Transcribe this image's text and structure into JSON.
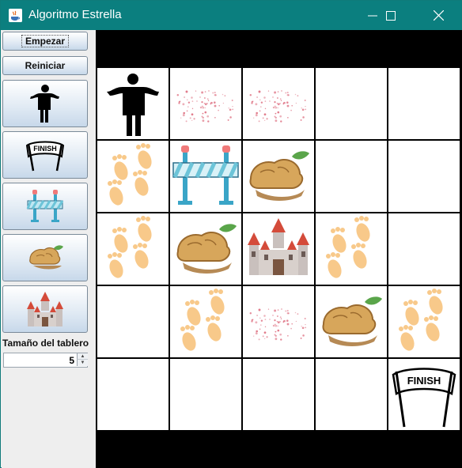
{
  "window": {
    "title": "Algoritmo Estrella",
    "controls": [
      "minimize-icon",
      "maximize-icon",
      "close-icon"
    ]
  },
  "sidebar": {
    "start_label": "Empezar",
    "reset_label": "Reiniciar",
    "tools": [
      {
        "name": "person-icon"
      },
      {
        "name": "finish-banner-icon"
      },
      {
        "name": "barrier-icon"
      },
      {
        "name": "rock-icon"
      },
      {
        "name": "castle-icon"
      }
    ],
    "board_size_label": "Tamaño del tablero",
    "board_size_value": "5"
  },
  "board": {
    "size": 5,
    "cells": [
      [
        "person",
        "dots",
        "dots",
        "empty",
        "empty"
      ],
      [
        "footprints",
        "barrier",
        "rock",
        "empty",
        "empty"
      ],
      [
        "footprints",
        "rock",
        "castle",
        "footprints",
        "empty"
      ],
      [
        "empty",
        "footprints",
        "dots",
        "rock",
        "footprints"
      ],
      [
        "empty",
        "empty",
        "empty",
        "empty",
        "finish"
      ]
    ],
    "finish_text": "FINISH"
  },
  "colors": {
    "titlebar": "#0b7f7f",
    "board_background": "#000000",
    "cell_background": "#ffffff",
    "footprint": "#f8c98a",
    "dots": "#e07a8a",
    "barrier_stripe": "#6cc4d8",
    "rock": "#d7a65b",
    "castle_roof": "#d44b3a"
  }
}
